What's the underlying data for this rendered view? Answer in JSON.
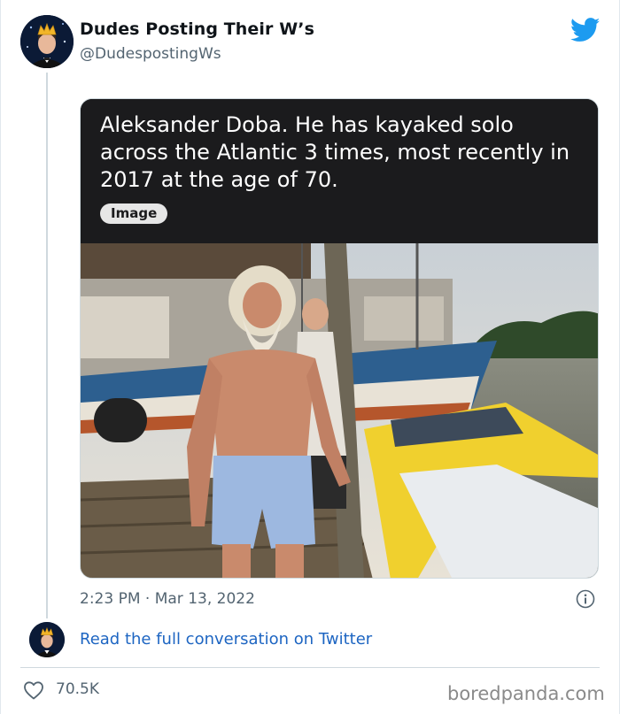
{
  "tweet": {
    "author_name": "Dudes Posting Their W’s",
    "author_handle": "@DudespostingWs",
    "timestamp": "2:23 PM · Mar 13, 2022",
    "read_more": "Read the full conversation on Twitter",
    "like_count": "70.5K"
  },
  "media": {
    "caption": "Aleksander Doba. He has kayaked solo across the Atlantic 3 times, most recently in 2017 at the age of 70.",
    "badge": "Image"
  },
  "watermark": "boredpanda.com",
  "icons": {
    "brand": "twitter-bird-icon",
    "info": "info-icon",
    "like": "heart-icon"
  },
  "colors": {
    "twitter_blue": "#1d9bf0",
    "link_blue": "#1d65c2",
    "secondary_text": "#536471",
    "caption_bg": "#1b1b1d"
  }
}
